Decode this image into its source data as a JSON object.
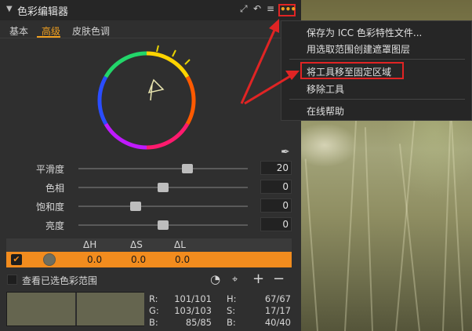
{
  "panel": {
    "title": "色彩编辑器",
    "icons": [
      "expand-icon",
      "reset-icon",
      "menu-icon",
      "more-icon"
    ]
  },
  "tabs": [
    {
      "label": "基本",
      "active": false
    },
    {
      "label": "高级",
      "active": true
    },
    {
      "label": "皮肤色调",
      "active": false
    }
  ],
  "sliders": [
    {
      "label": "平滑度",
      "value": "20",
      "fraction": 0.64
    },
    {
      "label": "色相",
      "value": "0",
      "fraction": 0.5
    },
    {
      "label": "饱和度",
      "value": "0",
      "fraction": 0.34
    },
    {
      "label": "亮度",
      "value": "0",
      "fraction": 0.5
    }
  ],
  "table": {
    "headers": [
      "ΔH",
      "ΔS",
      "ΔL"
    ],
    "row": {
      "checked": true,
      "dh": "0.0",
      "ds": "0.0",
      "dl": "0.0",
      "swatch_color": "#6e6e60"
    }
  },
  "view_selected": {
    "label": "查看已选色彩范围",
    "checked": false
  },
  "readouts": {
    "r_label": "R:",
    "r_value": "101/101",
    "g_label": "G:",
    "g_value": "103/103",
    "b_label": "B:",
    "b_value": "85/85",
    "h_label": "H:",
    "h_value": "67/67",
    "s_label": "S:",
    "s_value": "17/17",
    "b2_label": "B:",
    "b2_value": "40/40"
  },
  "swatch_color": "#65654f",
  "menu": {
    "items": [
      "保存为 ICC 色彩特性文件...",
      "用选取范围创建遮罩图层",
      "将工具移至固定区域",
      "移除工具",
      "在线帮助"
    ]
  },
  "colors": {
    "accent": "#f0a020",
    "row_highlight": "#f28c1e",
    "annotation": "#e02424"
  }
}
